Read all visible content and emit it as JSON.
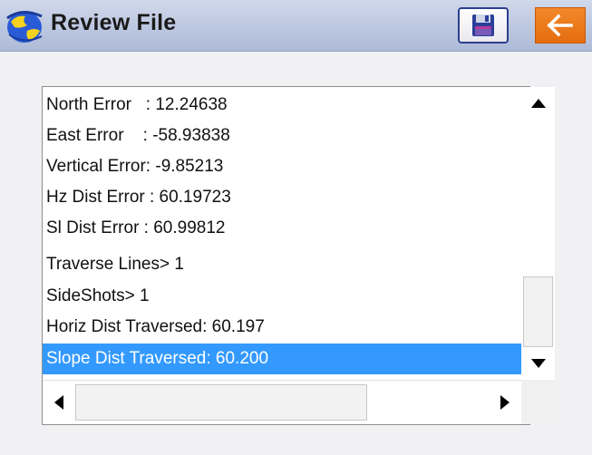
{
  "header": {
    "title": "Review File",
    "logo_icon": "globe-logo-icon",
    "save_icon": "floppy-disk-icon",
    "back_icon": "arrow-left-icon",
    "background_color": "#bcc7e0",
    "back_button_color": "#e8711a"
  },
  "list": {
    "items": [
      {
        "label": "North Error   : 12.24638"
      },
      {
        "label": "East Error    : -58.93838"
      },
      {
        "label": "Vertical Error: -9.85213"
      },
      {
        "label": "Hz Dist Error : 60.19723"
      },
      {
        "label": "Sl Dist Error : 60.99812"
      },
      {
        "label": "Traverse Lines> 1"
      },
      {
        "label": "SideShots> 1"
      },
      {
        "label": "Horiz Dist Traversed: 60.197"
      },
      {
        "label": "Slope Dist Traversed: 60.200"
      }
    ],
    "selected_index": 8,
    "selection_color": "#3399ff"
  },
  "scrollbars": {
    "up_icon": "triangle-up-icon",
    "down_icon": "triangle-down-icon",
    "left_icon": "triangle-left-icon",
    "right_icon": "triangle-right-icon"
  }
}
